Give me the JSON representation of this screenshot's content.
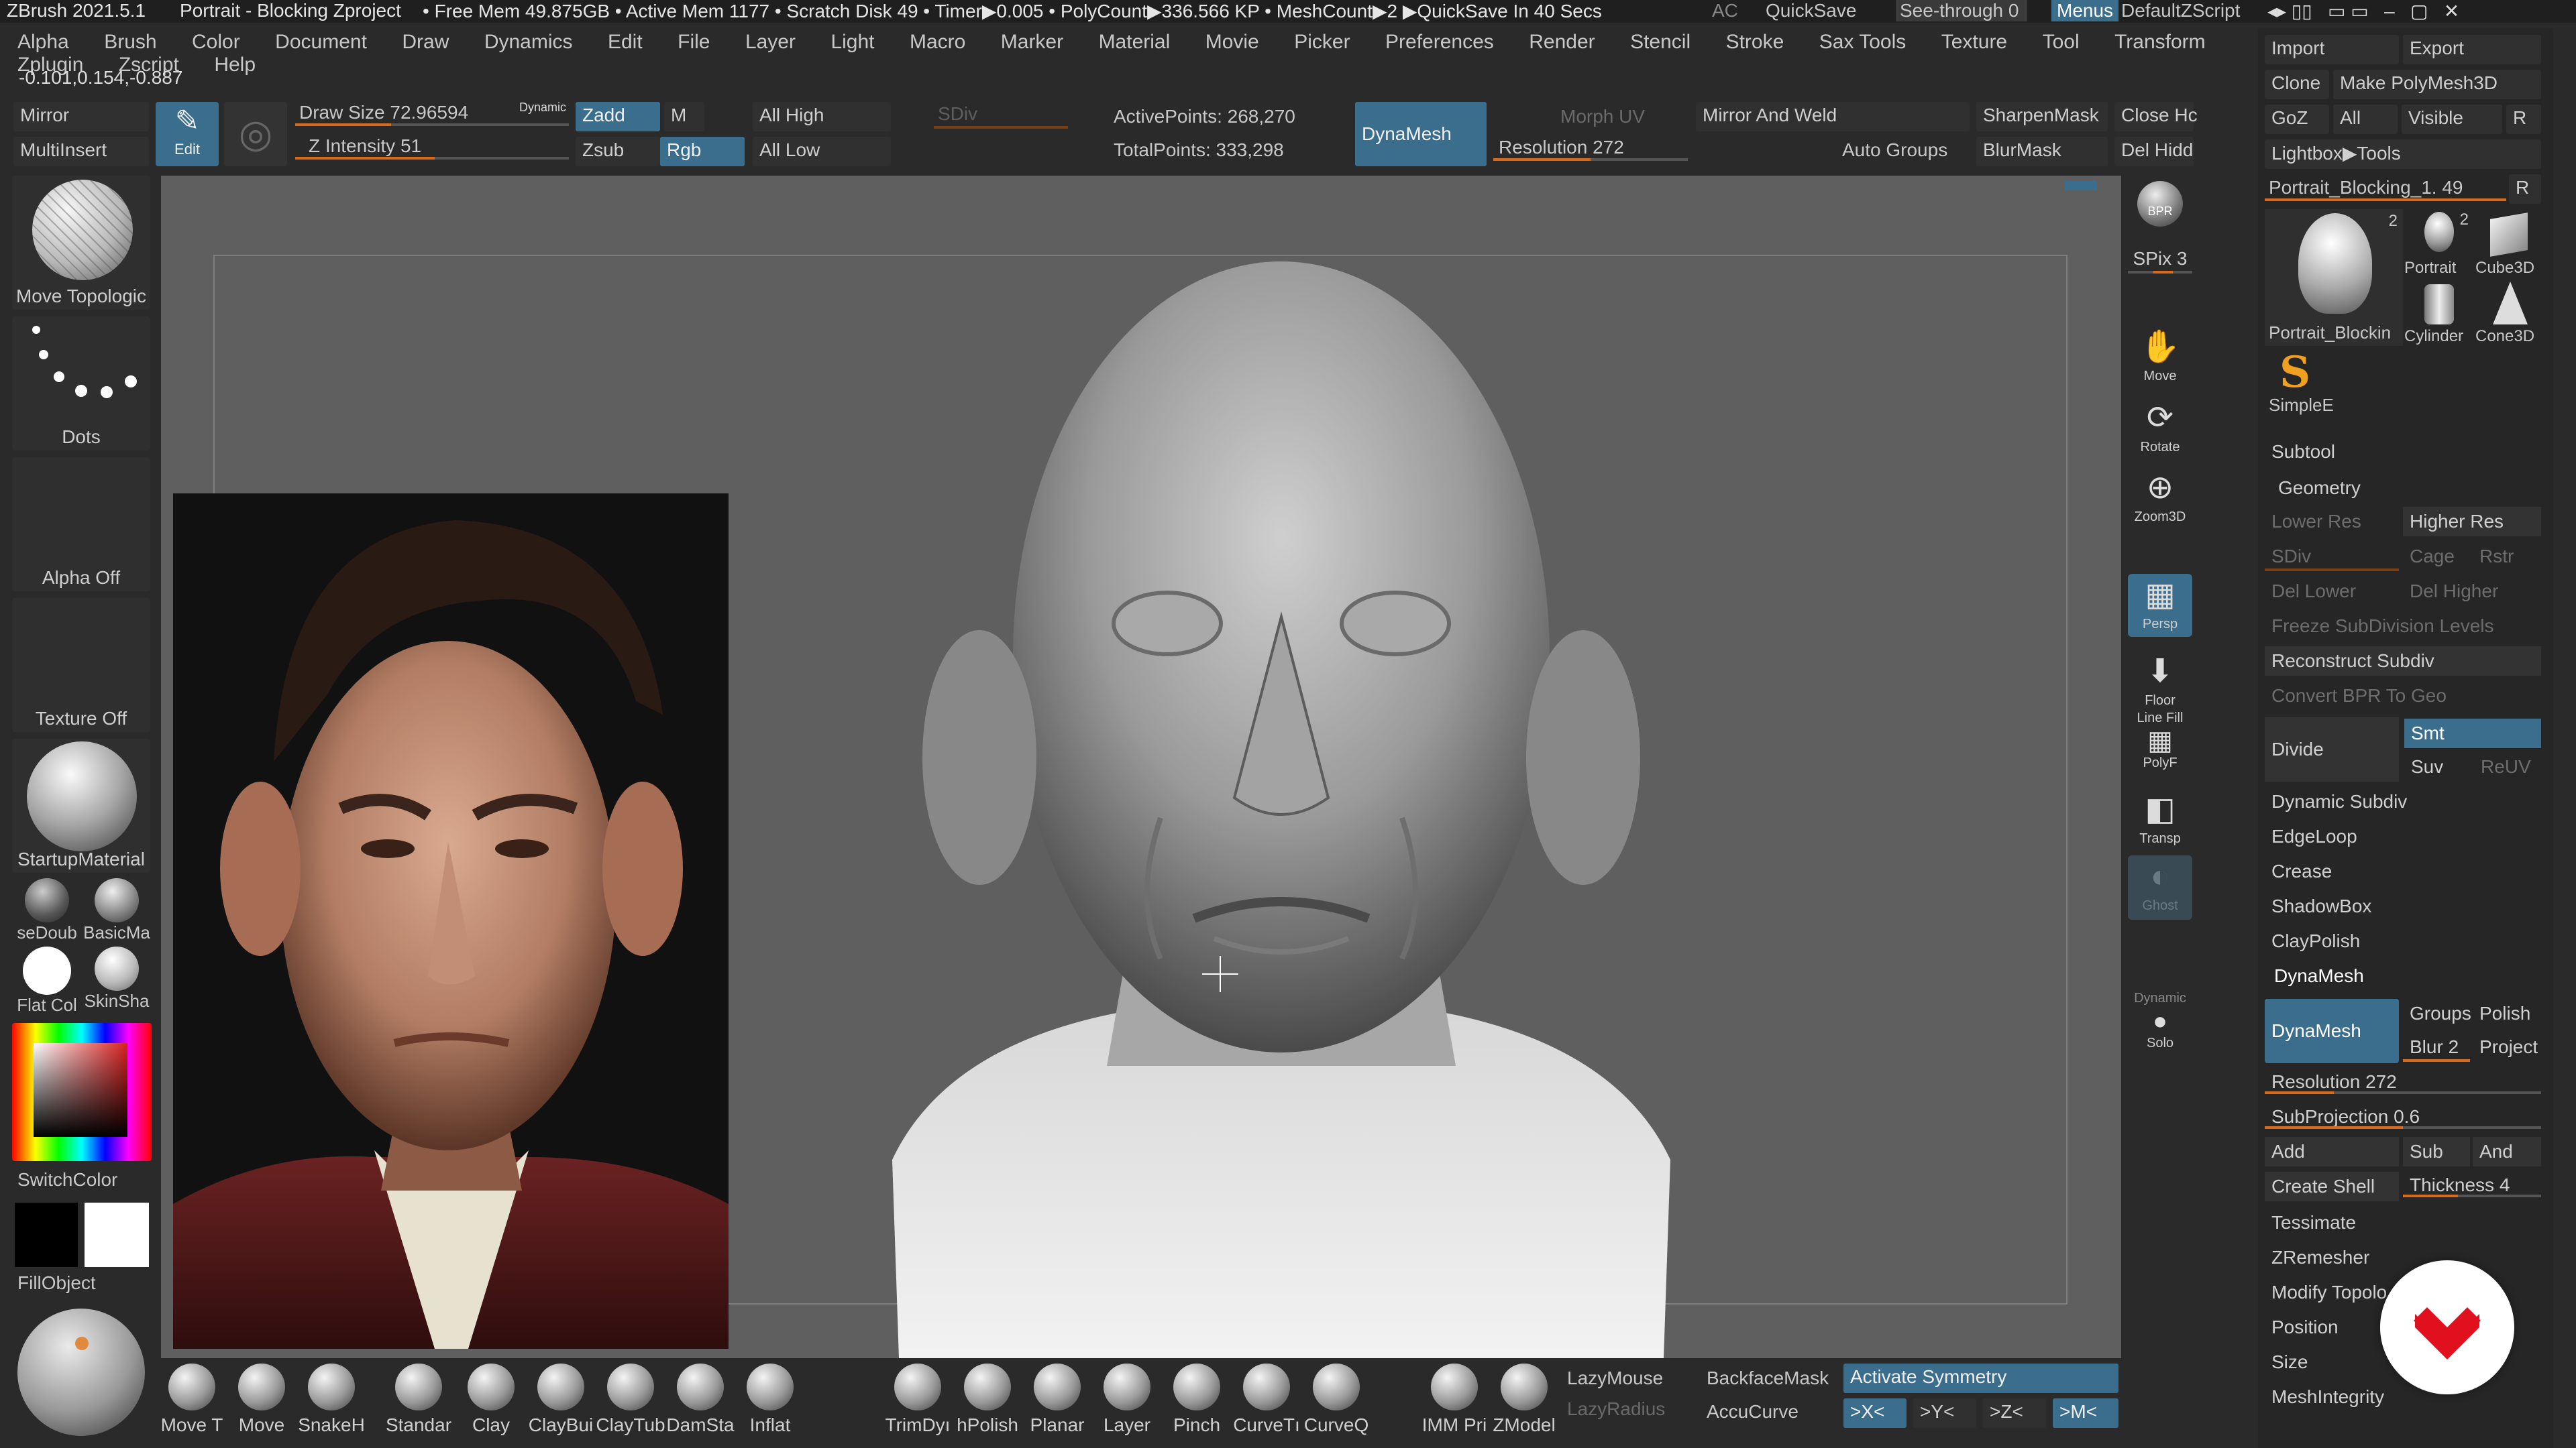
{
  "titlebar": {
    "app": "ZBrush 2021.5.1",
    "file": "Portrait - Blocking Zproject",
    "stats": "• Free Mem 49.875GB • Active Mem 1177 • Scratch Disk 49 • Timer▶0.005 • PolyCount▶336.566 KP • MeshCount▶2 ▶QuickSave In 40 Secs",
    "ac": "AC",
    "quicksave": "QuickSave",
    "see_through": "See-through   0",
    "menus": "Menus",
    "script": "DefaultZScript"
  },
  "menubar": [
    "Alpha",
    "Brush",
    "Color",
    "Document",
    "Draw",
    "Dynamics",
    "Edit",
    "File",
    "Layer",
    "Light",
    "Macro",
    "Marker",
    "Material",
    "Movie",
    "Picker",
    "Preferences",
    "Render",
    "Stencil",
    "Stroke",
    "Sax Tools",
    "Texture",
    "Tool",
    "Transform",
    "Zplugin",
    "Zscript",
    "Help"
  ],
  "coords": "-0.101,0.154,-0.887",
  "toolbar": {
    "mirror": "Mirror",
    "multiinsert": "MultiInsert",
    "edit": "Edit",
    "draw_size_label": "Draw Size 72.96594",
    "draw_size_fraction": 0.35,
    "dynamic": "Dynamic",
    "z_intensity_label": "Z Intensity 51",
    "z_intensity_fraction": 0.51,
    "zadd": "Zadd",
    "m": "M",
    "zsub": "Zsub",
    "rgb": "Rgb",
    "all_high": "All High",
    "all_low": "All Low",
    "sdiv": "SDiv",
    "active_points": "ActivePoints: 268,270",
    "total_points": "TotalPoints: 333,298",
    "dynamesh": "DynaMesh",
    "morph_uv": "Morph UV",
    "resolution": "Resolution 272",
    "mirror_weld": "Mirror And Weld",
    "auto_groups": "Auto Groups",
    "sharpen_mask": "SharpenMask",
    "blur_mask": "BlurMask",
    "close_holes": "Close Hc",
    "del_hidden": "Del Hidd"
  },
  "left_shelf": {
    "brush": "Move Topologic",
    "stroke": "Dots",
    "alpha": "Alpha Off",
    "texture": "Texture Off",
    "material": "StartupMaterial",
    "mat_a": "seDoub",
    "mat_b": "BasicMa",
    "mat_c": "Flat Col",
    "mat_d": "SkinSha",
    "switch_color": "SwitchColor",
    "fill_object": "FillObject"
  },
  "right_nav": [
    {
      "label": "BPR",
      "icon": "◉"
    },
    {
      "label": "SPix 3",
      "icon": ""
    },
    {
      "label": "Move",
      "icon": "✋"
    },
    {
      "label": "Rotate",
      "icon": "⟳"
    },
    {
      "label": "Zoom3D",
      "icon": "⊕"
    },
    {
      "label": "Persp",
      "icon": "▦"
    },
    {
      "label": "Floor",
      "icon": "⬇"
    },
    {
      "label": "PolyF",
      "icon": "▦"
    },
    {
      "label": "Transp",
      "icon": "◧"
    },
    {
      "label": "Ghost",
      "icon": "◐"
    },
    {
      "label": "Solo",
      "icon": "●"
    }
  ],
  "nav_extra": {
    "line_fill": "Line Fill",
    "dynamic": "Dynamic"
  },
  "tool_panel": {
    "import": "Import",
    "export": "Export",
    "clone": "Clone",
    "make_polymesh": "Make PolyMesh3D",
    "goz": "GoZ",
    "all": "All",
    "visible": "Visible",
    "r": "R",
    "lightbox_tools": "Lightbox▶Tools",
    "current_tool": "Portrait_Blocking_1. 49",
    "thumbs": [
      "Portrait_Blockin",
      "Portrait",
      "Cube3D",
      "Cylinder",
      "Cone3D",
      "SimpleE"
    ],
    "thumb_counts": [
      "2",
      "2"
    ],
    "subtool": "Subtool",
    "geometry": "Geometry",
    "lower_res": "Lower Res",
    "higher_res": "Higher Res",
    "sdiv": "SDiv",
    "cage": "Cage",
    "rstr": "Rstr",
    "del_lower": "Del Lower",
    "del_higher": "Del Higher",
    "freeze": "Freeze SubDivision Levels",
    "reconstruct": "Reconstruct Subdiv",
    "convert_bpr": "Convert BPR To Geo",
    "divide": "Divide",
    "smt": "Smt",
    "suv": "Suv",
    "reuv": "ReUV",
    "dynamic_subdiv": "Dynamic Subdiv",
    "edgeloop": "EdgeLoop",
    "crease": "Crease",
    "shadowbox": "ShadowBox",
    "claypolish": "ClayPolish",
    "dynamesh_section": "DynaMesh",
    "dynamesh_btn": "DynaMesh",
    "groups": "Groups",
    "polish": "Polish",
    "blur": "Blur 2",
    "project": "Project",
    "resolution": "Resolution 272",
    "subprojection": "SubProjection 0.6",
    "add": "Add",
    "sub": "Sub",
    "and": "And",
    "create_shell": "Create Shell",
    "thickness": "Thickness 4",
    "tessimate": "Tessimate",
    "zremesher": "ZRemesher",
    "modify_topology": "Modify Topolo",
    "position": "Position",
    "size": "Size",
    "mesh_integrity": "MeshIntegrity"
  },
  "bottom_shelf": {
    "brushes": [
      "Move T",
      "Move",
      "SnakeH",
      "Standar",
      "Clay",
      "ClayBui",
      "ClayTub",
      "DamSta",
      "Inflat",
      "TrimDyı",
      "hPolish",
      "Planar",
      "Layer",
      "Pinch",
      "CurveTı",
      "CurveQ",
      "IMM Pri",
      "ZModel"
    ],
    "lazy_mouse": "LazyMouse",
    "lazy_radius": "LazyRadius",
    "backface_mask": "BackfaceMask",
    "accucurve": "AccuCurve",
    "activate_symmetry": "Activate Symmetry",
    "sym_x": ">X<",
    "sym_y": ">Y<",
    "sym_z": ">Z<",
    "sym_m": ">M<"
  },
  "colors": {
    "accent": "#d86a1e",
    "active": "#3b6e8c",
    "logo": "#e0101e"
  }
}
